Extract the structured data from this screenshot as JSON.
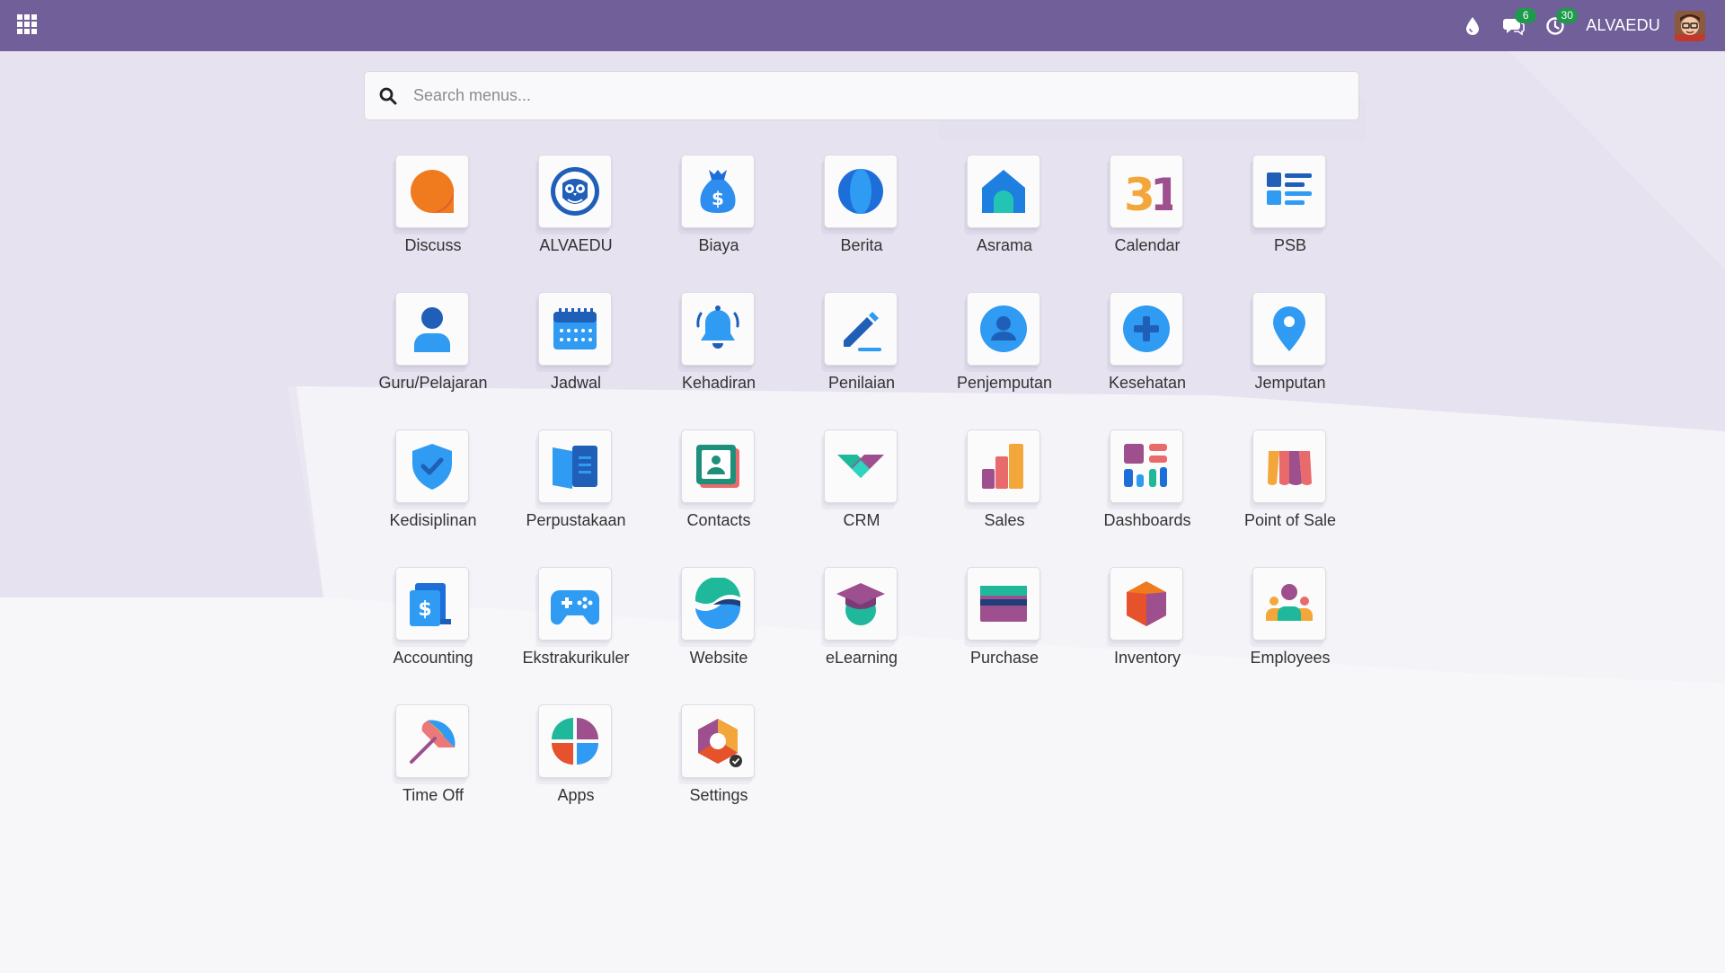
{
  "navbar": {
    "company": "ALVAEDU",
    "messages_count": "6",
    "activities_count": "30",
    "background": "#715f99",
    "icons": [
      "apps-grid-icon",
      "drop-icon",
      "chat-icon",
      "clock-icon"
    ]
  },
  "search": {
    "placeholder": "Search menus..."
  },
  "apps": [
    {
      "label": "Discuss",
      "icon": "discuss-icon"
    },
    {
      "label": "ALVAEDU",
      "icon": "owl-icon"
    },
    {
      "label": "Biaya",
      "icon": "money-bag-icon"
    },
    {
      "label": "Berita",
      "icon": "globe-icon"
    },
    {
      "label": "Asrama",
      "icon": "house-icon"
    },
    {
      "label": "Calendar",
      "icon": "calendar-31-icon"
    },
    {
      "label": "PSB",
      "icon": "list-icon"
    },
    {
      "label": "Guru/Pelajaran",
      "icon": "person-icon"
    },
    {
      "label": "Jadwal",
      "icon": "schedule-icon"
    },
    {
      "label": "Kehadiran",
      "icon": "bell-icon"
    },
    {
      "label": "Penilaian",
      "icon": "pencil-icon"
    },
    {
      "label": "Penjemputan",
      "icon": "user-circle-icon"
    },
    {
      "label": "Kesehatan",
      "icon": "plus-circle-icon"
    },
    {
      "label": "Jemputan",
      "icon": "map-pin-icon"
    },
    {
      "label": "Kedisiplinan",
      "icon": "shield-check-icon"
    },
    {
      "label": "Perpustakaan",
      "icon": "book-icon"
    },
    {
      "label": "Contacts",
      "icon": "contact-card-icon"
    },
    {
      "label": "CRM",
      "icon": "handshake-icon"
    },
    {
      "label": "Sales",
      "icon": "bar-chart-icon"
    },
    {
      "label": "Dashboards",
      "icon": "dashboard-icon"
    },
    {
      "label": "Point of Sale",
      "icon": "shop-awning-icon"
    },
    {
      "label": "Accounting",
      "icon": "invoice-dollar-icon"
    },
    {
      "label": "Ekstrakurikuler",
      "icon": "gamepad-icon"
    },
    {
      "label": "Website",
      "icon": "website-icon"
    },
    {
      "label": "eLearning",
      "icon": "graduation-cap-icon"
    },
    {
      "label": "Purchase",
      "icon": "credit-card-icon"
    },
    {
      "label": "Inventory",
      "icon": "cube-icon"
    },
    {
      "label": "Employees",
      "icon": "people-icon"
    },
    {
      "label": "Time Off",
      "icon": "umbrella-icon"
    },
    {
      "label": "Apps",
      "icon": "apps-pie-icon"
    },
    {
      "label": "Settings",
      "icon": "settings-hexagon-icon"
    }
  ]
}
